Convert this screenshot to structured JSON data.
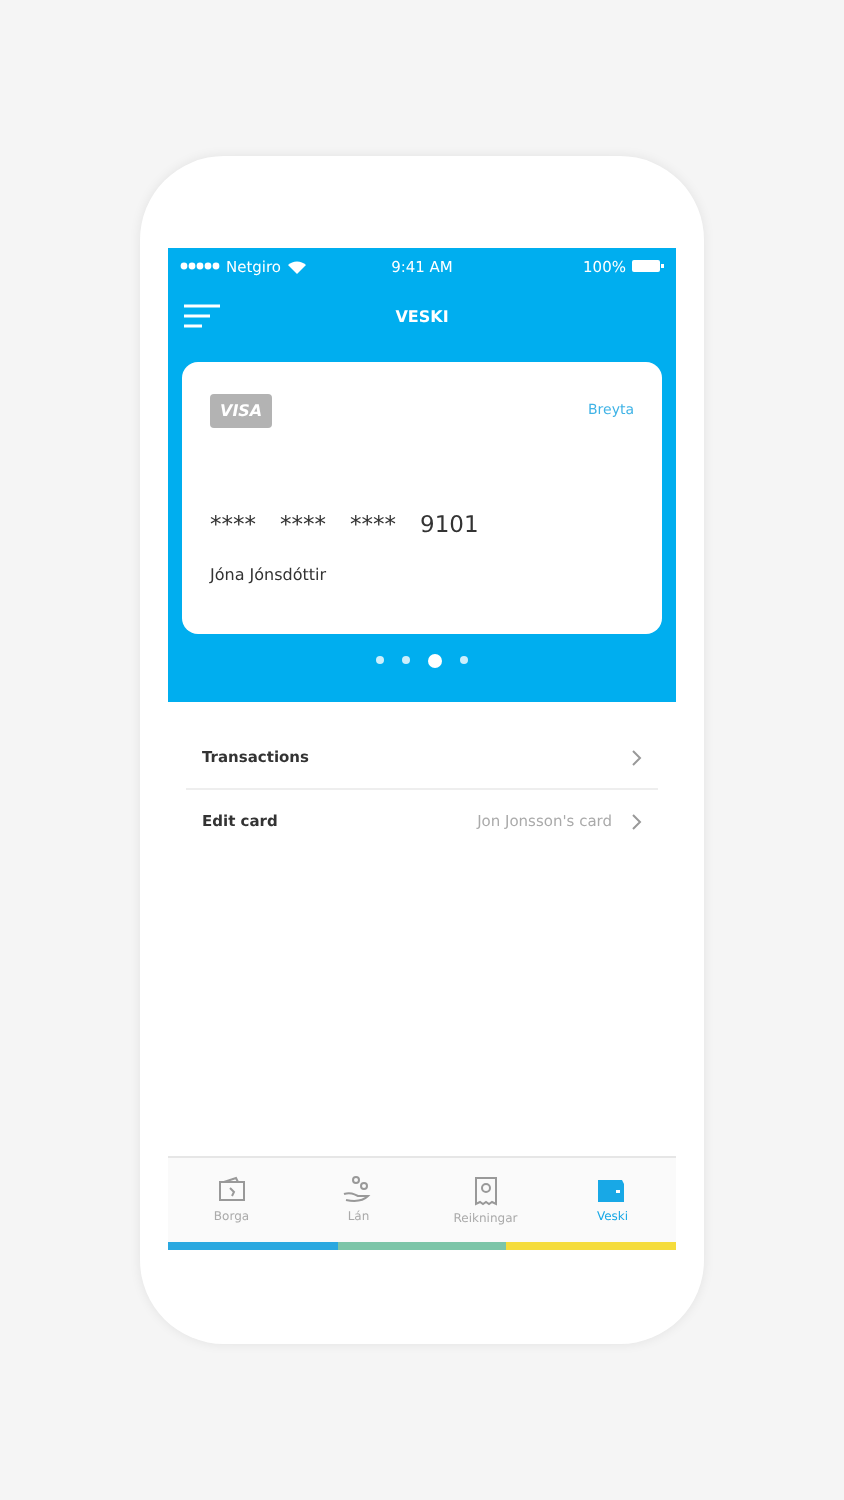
{
  "status_bar": {
    "carrier": "Netgiro",
    "time": "9:41 AM",
    "battery": "100%"
  },
  "nav": {
    "title": "VESKI"
  },
  "card": {
    "brand": "VISA",
    "action": "Breyta",
    "number_groups": [
      "****",
      "****",
      "****",
      "9101"
    ],
    "holder": "Jóna Jónsdóttir"
  },
  "pager": [
    {
      "selected": false
    },
    {
      "selected": false
    },
    {
      "selected": true
    },
    {
      "selected": false
    }
  ],
  "menu": [
    {
      "label": "Transactions"
    },
    {
      "label": "Edit card",
      "detail": "Jon Jonsson's card"
    }
  ],
  "tab_bar": [
    {
      "label": "Borga",
      "kind": "pay",
      "selected": false
    },
    {
      "label": "Lán",
      "kind": "loan",
      "selected": false
    },
    {
      "label": "Reikningar",
      "kind": "bills",
      "selected": false
    },
    {
      "label": "Veski",
      "kind": "wallet",
      "selected": true
    }
  ]
}
